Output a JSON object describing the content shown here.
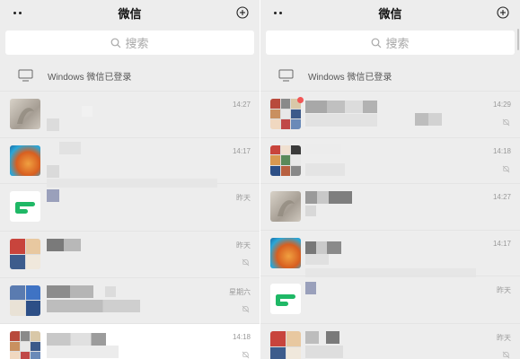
{
  "app": {
    "title": "微信"
  },
  "search": {
    "placeholder": "搜索"
  },
  "banner": {
    "text": "Windows 微信已登录"
  },
  "left_panel": {
    "chats": [
      {
        "time": "14:27",
        "muted": false
      },
      {
        "time": "14:17",
        "muted": false
      },
      {
        "time": "昨天",
        "muted": false
      },
      {
        "time": "昨天",
        "muted": true
      },
      {
        "time": "星期六",
        "muted": true
      },
      {
        "time": "14:18",
        "muted": true
      }
    ]
  },
  "right_panel": {
    "chats": [
      {
        "time": "14:29",
        "muted": true,
        "unread_dot": true
      },
      {
        "time": "14:18",
        "muted": true
      },
      {
        "time": "14:27",
        "muted": false
      },
      {
        "time": "14:17",
        "muted": false
      },
      {
        "time": "昨天",
        "muted": false
      },
      {
        "time": "昨天",
        "muted": true
      }
    ]
  },
  "colors": {
    "background": "#ededed",
    "search_bg": "#ffffff",
    "unread": "#f25656",
    "text_secondary": "#9a9a9a"
  },
  "icons": [
    "more-dots-icon",
    "add-icon",
    "search-icon",
    "monitor-icon",
    "mute-bell-icon"
  ]
}
